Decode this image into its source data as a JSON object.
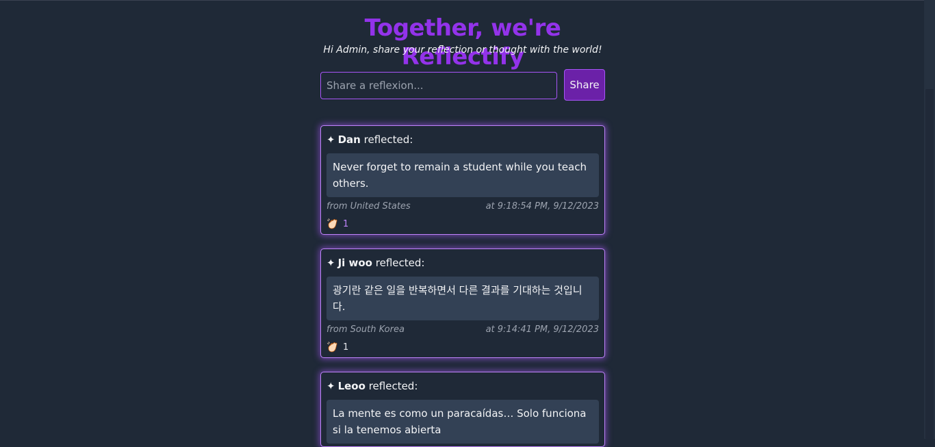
{
  "header": {
    "title": "Together, we're Reflectify",
    "subtitle": "Hi Admin, share your reflection or thought with the world!"
  },
  "share": {
    "placeholder": "Share a reflexion...",
    "button_label": "Share"
  },
  "posts": [
    {
      "star": "✦",
      "author": "Dan",
      "verb": "reflected:",
      "text": "Never forget to remain a student while you teach others.",
      "location": "from United States",
      "time": "at 9:18:54 PM, 9/12/2023",
      "claps": "1",
      "clap_icon": "clapping-hands-icon"
    },
    {
      "star": "✦",
      "author": "Ji woo",
      "verb": "reflected:",
      "text": "광기란 같은 일을 반복하면서 다른 결과를 기대하는 것입니다.",
      "location": "from South Korea",
      "time": "at 9:14:41 PM, 9/12/2023",
      "claps": "1",
      "clap_icon": "clapping-hands-icon"
    },
    {
      "star": "✦",
      "author": "Leoo",
      "verb": "reflected:",
      "text": "La mente es como un paracaídas… Solo funciona si la tenemos abierta",
      "location": "",
      "time": "",
      "claps": "",
      "clap_icon": "clapping-hands-icon"
    }
  ],
  "colors": {
    "background": "#1f2937",
    "accent": "#9333ea",
    "card_border": "#c084fc",
    "button_bg": "#6b21a8"
  }
}
